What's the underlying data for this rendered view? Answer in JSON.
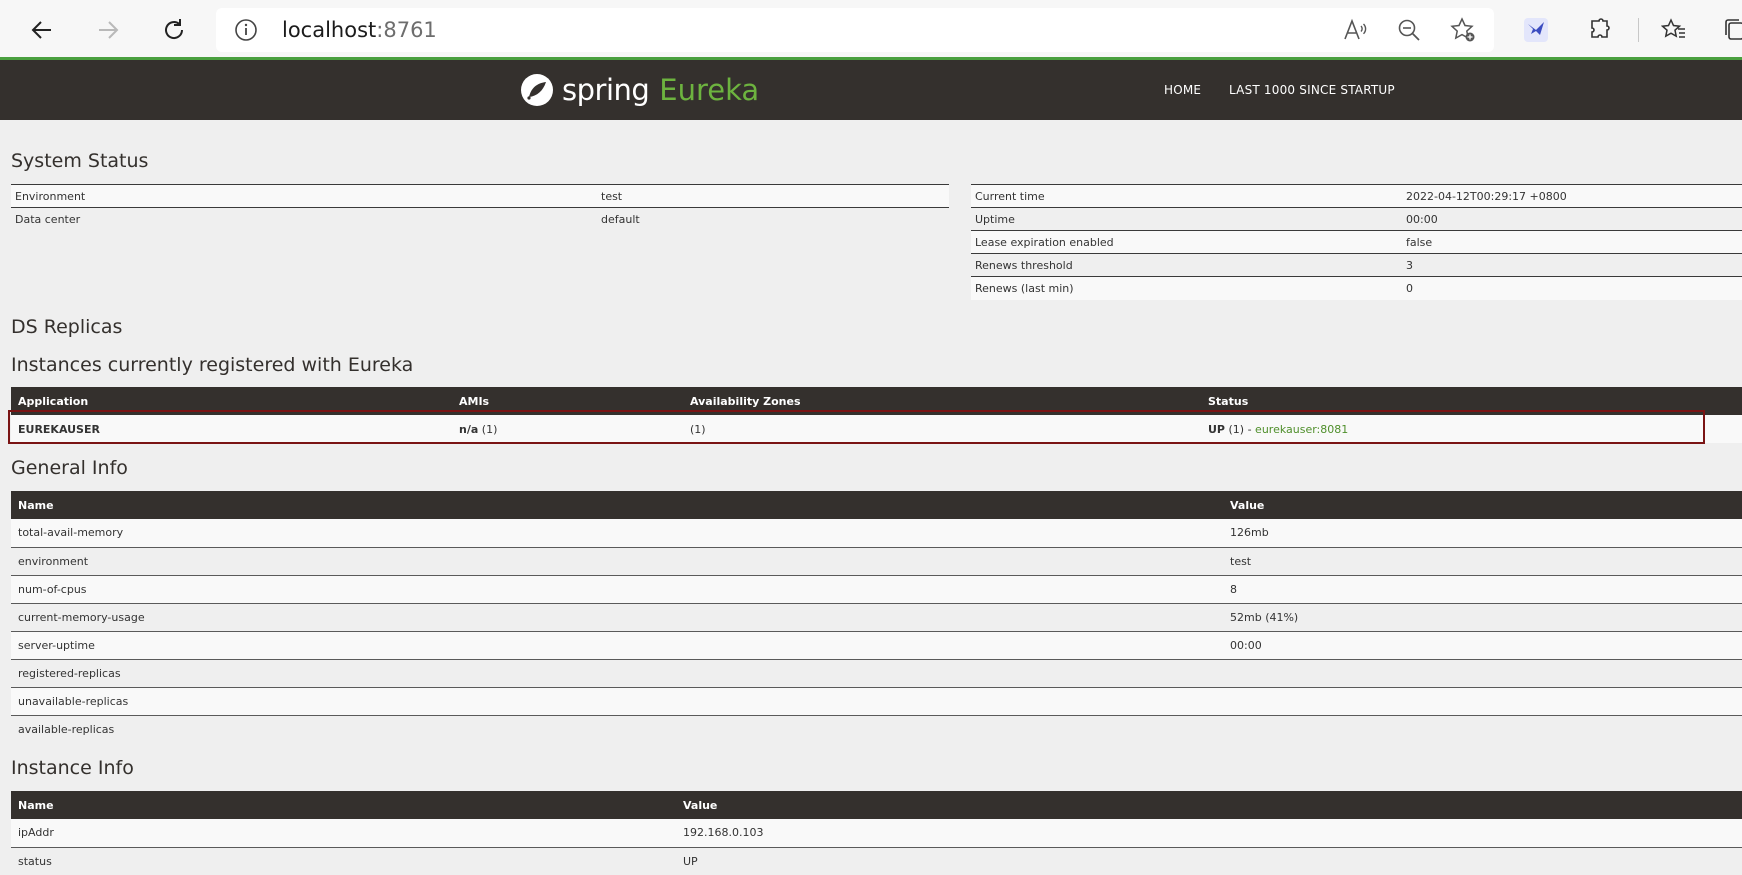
{
  "browser": {
    "url_host": "localhost",
    "url_port": ":8761",
    "icons": [
      "back-arrow-icon",
      "forward-arrow-icon",
      "refresh-icon",
      "info-icon",
      "read-aloud-icon",
      "zoom-out-icon",
      "add-favorite-icon",
      "extension-bird-icon",
      "extensions-puzzle-icon",
      "favorites-icon",
      "collections-icon"
    ]
  },
  "header": {
    "brand_spring": "spring",
    "brand_eureka": "Eureka",
    "nav": [
      "HOME",
      "LAST 1000 SINCE STARTUP"
    ]
  },
  "system_status": {
    "title": "System Status",
    "left": [
      {
        "label": "Environment",
        "value": "test"
      },
      {
        "label": "Data center",
        "value": "default"
      }
    ],
    "right": [
      {
        "label": "Current time",
        "value": "2022-04-12T00:29:17 +0800"
      },
      {
        "label": "Uptime",
        "value": "00:00"
      },
      {
        "label": "Lease expiration enabled",
        "value": "false"
      },
      {
        "label": "Renews threshold",
        "value": "3"
      },
      {
        "label": "Renews (last min)",
        "value": "0"
      }
    ]
  },
  "ds_replicas": {
    "title": "DS Replicas"
  },
  "instances": {
    "title": "Instances currently registered with Eureka",
    "columns": [
      "Application",
      "AMIs",
      "Availability Zones",
      "Status"
    ],
    "rows": [
      {
        "application": "EUREKAUSER",
        "amis_bold": "n/a",
        "amis_count": " (1)",
        "zones": "(1)",
        "status_bold": "UP",
        "status_rest": " (1) - ",
        "instance_link": "eurekauser:8081"
      }
    ]
  },
  "general_info": {
    "title": "General Info",
    "columns": [
      "Name",
      "Value"
    ],
    "rows": [
      {
        "name": "total-avail-memory",
        "value": "126mb"
      },
      {
        "name": "environment",
        "value": "test"
      },
      {
        "name": "num-of-cpus",
        "value": "8"
      },
      {
        "name": "current-memory-usage",
        "value": "52mb (41%)"
      },
      {
        "name": "server-uptime",
        "value": "00:00"
      },
      {
        "name": "registered-replicas",
        "value": ""
      },
      {
        "name": "unavailable-replicas",
        "value": ""
      },
      {
        "name": "available-replicas",
        "value": ""
      }
    ]
  },
  "instance_info": {
    "title": "Instance Info",
    "columns": [
      "Name",
      "Value"
    ],
    "rows": [
      {
        "name": "ipAddr",
        "value": "192.168.0.103"
      },
      {
        "name": "status",
        "value": "UP"
      }
    ]
  },
  "colors": {
    "nav_bg": "#34302d",
    "spring_green": "#6db33f",
    "highlight": "#7a1414"
  }
}
